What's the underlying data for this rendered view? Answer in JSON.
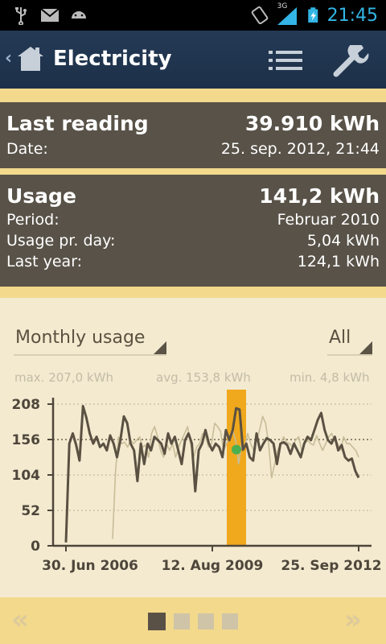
{
  "statusbar": {
    "icons": [
      "usb-icon",
      "gmail-icon",
      "android-debug-icon",
      "rotation-lock-icon",
      "signal-3g-icon",
      "battery-charging-icon"
    ],
    "network": "3G",
    "time": "21:45"
  },
  "actionbar": {
    "title": "Electricity",
    "icons": [
      "back-chevron-icon",
      "home-icon",
      "list-icon",
      "wrench-icon"
    ]
  },
  "last_reading": {
    "label": "Last reading",
    "value": "39.910 kWh",
    "date_label": "Date:",
    "date_value": "25. sep. 2012, 21:44"
  },
  "usage": {
    "label": "Usage",
    "value": "141,2 kWh",
    "period_label": "Period:",
    "period_value": "Februar 2010",
    "perday_label": "Usage pr. day:",
    "perday_value": "5,04 kWh",
    "lastyear_label": "Last year:",
    "lastyear_value": "124,1 kWh"
  },
  "chart_controls": {
    "type_selected": "Monthly usage",
    "range_selected": "All"
  },
  "stats": {
    "max": "max. 207,0 kWh",
    "avg": "avg. 153,8 kWh",
    "min": "min. 4,8 kWh"
  },
  "colors": {
    "accent": "#f0a81c",
    "panel": "#585248",
    "line_dark": "#5a5142",
    "line_light": "#c9bd98",
    "marker": "#4caf50"
  },
  "chart_data": {
    "type": "line",
    "ylim": [
      0,
      208
    ],
    "yticks": [
      "0",
      "52",
      "104",
      "156",
      "208"
    ],
    "xticks": [
      "30. Jun 2006",
      "12. Aug 2009",
      "25. Sep 2012"
    ],
    "highlight_period": "Februar 2010",
    "series": [
      {
        "values": [
          5,
          150,
          165,
          148,
          125,
          205,
          188,
          165,
          150,
          160,
          145,
          150,
          140,
          162,
          150,
          130,
          155,
          190,
          180,
          150,
          140,
          95,
          150,
          120,
          150,
          140,
          160,
          155,
          150,
          135,
          165,
          150,
          160,
          140,
          120,
          155,
          165,
          150,
          80,
          140,
          150,
          170,
          150,
          140,
          150,
          145,
          130,
          170,
          155,
          170,
          202,
          200,
          141,
          150,
          130,
          125,
          165,
          140,
          150,
          158,
          155,
          150,
          120,
          150,
          152,
          148,
          135,
          150,
          140,
          130,
          150,
          160,
          155,
          170,
          185,
          195,
          170,
          155,
          150,
          160,
          140,
          148,
          130,
          125,
          128,
          110,
          100
        ]
      },
      {
        "values": [
          10,
          110,
          160,
          150,
          152,
          145,
          155,
          150,
          155,
          160,
          145,
          148,
          130,
          165,
          175,
          160,
          140,
          130,
          150,
          140,
          150,
          130,
          145,
          155,
          165,
          175,
          150,
          130,
          145,
          150,
          165,
          160,
          145,
          150,
          180,
          175,
          168,
          140,
          150,
          160,
          170,
          155,
          120,
          150,
          145,
          165,
          150,
          140,
          155,
          170,
          190,
          180,
          150,
          100,
          120,
          140,
          150,
          160,
          152,
          150,
          145,
          155,
          160,
          140,
          150,
          155,
          150,
          148,
          162,
          150,
          140,
          150,
          160,
          165,
          155,
          150,
          140,
          160,
          150,
          150,
          145,
          140,
          130
        ]
      }
    ]
  }
}
